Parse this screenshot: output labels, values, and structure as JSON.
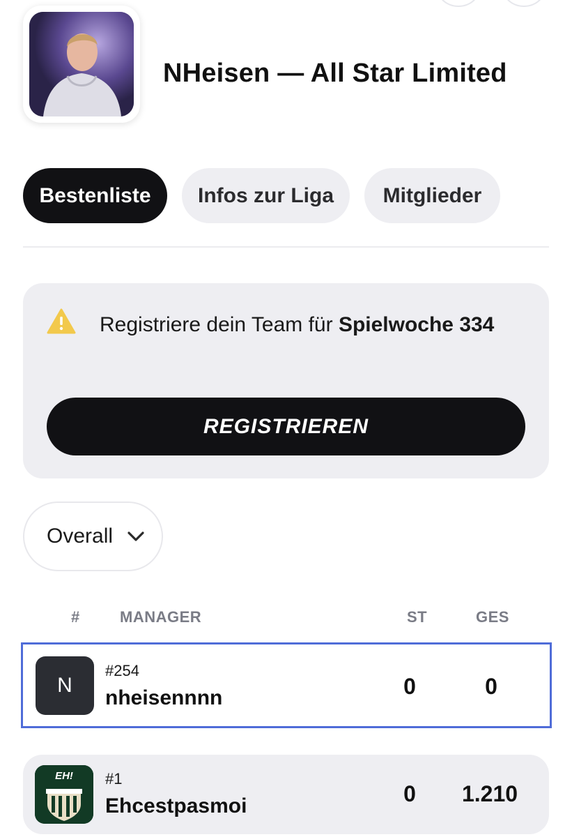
{
  "league": {
    "title": "NHeisen — All Star Limited"
  },
  "tabs": [
    {
      "label": "Bestenliste",
      "active": true
    },
    {
      "label": "Infos zur Liga",
      "active": false
    },
    {
      "label": "Mitglieder",
      "active": false
    }
  ],
  "registration": {
    "text_prefix": "Registriere dein Team für ",
    "text_bold": "Spielwoche 334",
    "button_label": "REGISTRIEREN",
    "icon": "warning-icon"
  },
  "filter": {
    "selected": "Overall",
    "icon": "chevron-down-icon"
  },
  "table": {
    "headers": {
      "rank": "#",
      "manager": "MANAGER",
      "st": "ST",
      "ges": "GES"
    },
    "rows": [
      {
        "initial": "N",
        "rank": "#254",
        "name": "nheisennnn",
        "st": "0",
        "ges": "0",
        "highlighted": true
      },
      {
        "avatar_text": "EH!",
        "rank": "#1",
        "name": "Ehcestpasmoi",
        "st": "0",
        "ges": "1.210",
        "highlighted": false
      }
    ]
  },
  "colors": {
    "accent_dark": "#111114",
    "card_bg": "#eeeef2",
    "highlight_border": "#4f6cd8",
    "warning": "#f2c94c"
  }
}
